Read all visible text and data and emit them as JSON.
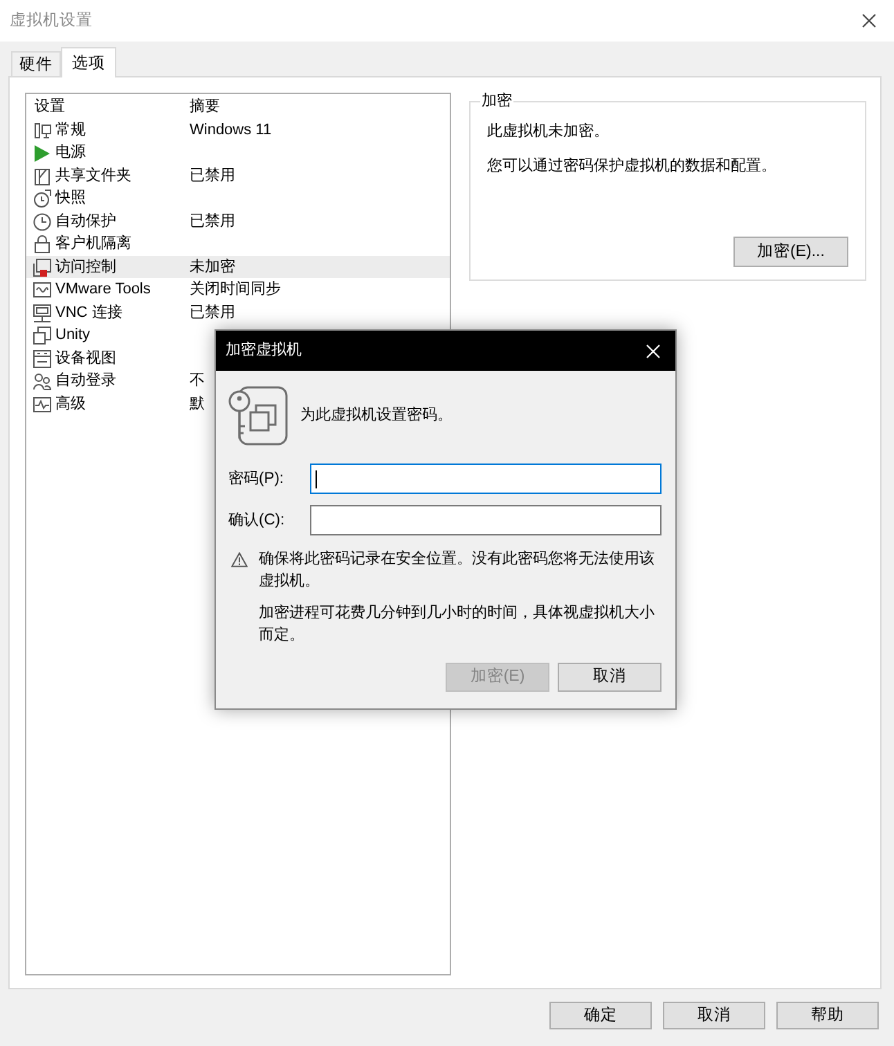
{
  "window": {
    "title": "虚拟机设置"
  },
  "tabs": [
    {
      "label": "硬件",
      "selected": false
    },
    {
      "label": "选项",
      "selected": true
    }
  ],
  "settings_list": {
    "columns": [
      "设置",
      "摘要"
    ],
    "items": [
      {
        "name": "常规",
        "summary": "Windows 11",
        "selected": false
      },
      {
        "name": "电源",
        "selected": false
      },
      {
        "name": "共享文件夹",
        "summary": "已禁用",
        "selected": false
      },
      {
        "name": "快照",
        "selected": false
      },
      {
        "name": "自动保护",
        "summary": "已禁用",
        "selected": false
      },
      {
        "name": "客户机隔离",
        "selected": false
      },
      {
        "name": "访问控制",
        "summary": "未加密",
        "selected": true
      },
      {
        "name": "VMware Tools",
        "summary": "关闭时间同步",
        "selected": false
      },
      {
        "name": "VNC 连接",
        "summary": "已禁用",
        "selected": false
      },
      {
        "name": "Unity",
        "selected": false
      },
      {
        "name": "设备视图",
        "selected": false
      },
      {
        "name": "自动登录",
        "summary": "不",
        "selected": false
      },
      {
        "name": "高级",
        "summary": "默",
        "selected": false
      }
    ]
  },
  "encryption_group": {
    "title": "加密",
    "status": "此虚拟机未加密。",
    "description": "您可以通过密码保护虚拟机的数据和配置。",
    "button": "加密(E)..."
  },
  "dialog": {
    "title": "加密虚拟机",
    "prompt": "为此虚拟机设置密码。",
    "fields": [
      {
        "label": "密码(P):",
        "focused": true
      },
      {
        "label": "确认(C):",
        "focused": false
      }
    ],
    "warning": "确保将此密码记录在安全位置。没有此密码您将无法使用该虚拟机。",
    "note": "加密进程可花费几分钟到几小时的时间，具体视虚拟机大小而定。",
    "buttons": [
      {
        "label": "加密(E)",
        "disabled": true
      },
      {
        "label": "取消",
        "disabled": false
      }
    ]
  },
  "buttons": [
    "确定",
    "取消",
    "帮助"
  ]
}
